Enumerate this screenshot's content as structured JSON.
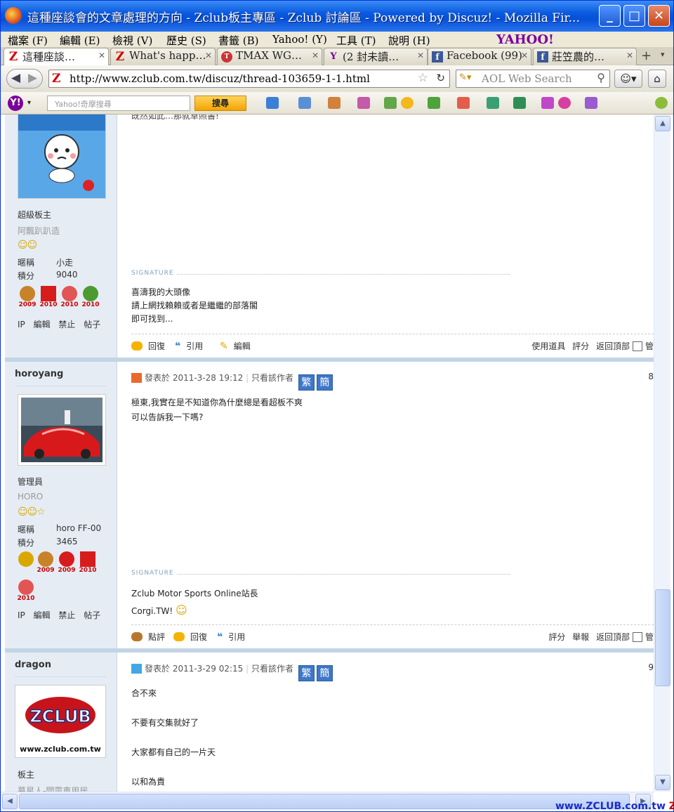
{
  "window": {
    "title": "這種座談會的文章處理的方向 - Zclub板主專區 - Zclub 討論區 - Powered by Discuz! - Mozilla Fir...",
    "minimize": "_",
    "maximize": "□",
    "close": "✕"
  },
  "menu": [
    "檔案 (F)",
    "編輯 (E)",
    "檢視 (V)",
    "歷史 (S)",
    "書籤 (B)",
    "Yahoo! (Y)",
    "工具 (T)",
    "說明 (H)"
  ],
  "yahoo_brand": "YAHOO!",
  "tabs": [
    {
      "label": "這種座談…",
      "favicon": "Z",
      "active": true
    },
    {
      "label": "What's happ…",
      "favicon": "Z",
      "active": false
    },
    {
      "label": "TMAX WG…",
      "favicon": "T",
      "active": false
    },
    {
      "label": "(2 封未讀…",
      "favicon": "Y",
      "active": false
    },
    {
      "label": "Facebook (99)",
      "favicon": "f",
      "active": false
    },
    {
      "label": "莊笠農的…",
      "favicon": "f",
      "active": false
    }
  ],
  "nav": {
    "url": "http://www.zclub.com.tw/discuz/thread-103659-1-1.html",
    "search_engine": "AOL Web Search"
  },
  "yahoo_toolbar": {
    "placeholder": "Yahoo!奇摩搜尋",
    "search_button": "搜尋"
  },
  "posts": [
    {
      "partial_text_top": "既然如此…那就草照書!",
      "rank": "超級板主",
      "title": "阿飄趴趴造",
      "fields": [
        {
          "k": "暱稱",
          "v": "小走"
        },
        {
          "k": "積分",
          "v": "9040"
        }
      ],
      "medal_years": [
        "2009",
        "2010",
        "2010",
        "2010"
      ],
      "admin_links": "IP 編輯 禁止 帖子",
      "signature_label": "SIGNATURE",
      "signature_lines": [
        "喜濤我的大頭像",
        "請上網找賴賴或者是繼繼的部落閣",
        "即可找到..."
      ],
      "actions": [
        "回復",
        "引用",
        "編輯"
      ],
      "right_actions": "使用道具 評分 返回頂部",
      "right_tail": "管"
    },
    {
      "username": "horoyang",
      "posted": "發表於 2011-3-28 19:12",
      "only_author": "只看該作者",
      "trad": "繁",
      "simp": "簡",
      "floor": "8",
      "body": [
        "極東,我實在是不知道你為什麼總是看超板不爽",
        "可以告訴我一下嗎?"
      ],
      "rank": "管理員",
      "title": "HORO",
      "fields": [
        {
          "k": "暱稱",
          "v": "horo FF-00"
        },
        {
          "k": "積分",
          "v": "3465"
        }
      ],
      "medal_years": [
        "",
        "2009",
        "2009",
        "2010",
        "2010"
      ],
      "admin_links": "IP 編輯 禁止 帖子",
      "signature_label": "SIGNATURE",
      "signature_lines": [
        "Zclub Motor Sports Online站長",
        "Corgi.TW!"
      ],
      "actions": [
        "點評",
        "回復",
        "引用"
      ],
      "right_actions": "評分 舉報 返回頂部",
      "right_tail": "管"
    },
    {
      "username": "dragon",
      "posted": "發表於 2011-3-29 02:15",
      "only_author": "只看該作者",
      "trad": "繁",
      "simp": "簡",
      "floor": "9",
      "avatar_text": "www.zclub.com.tw",
      "avatar_logo": "ZCLUB",
      "body": [
        "合不來",
        "不要有交集就好了",
        "大家都有自己的一片天",
        "以和為貴"
      ],
      "rank": "板主",
      "title": "慕星人-間靈車用居"
    }
  ],
  "watermark": {
    "url": "www.ZCLUB.com.tw",
    "tail": "Z板"
  }
}
